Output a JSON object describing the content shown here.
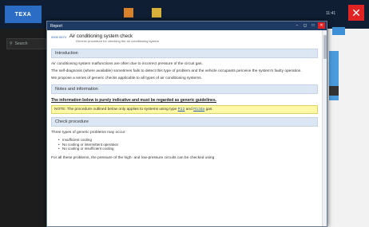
{
  "app": {
    "logo": "TEXA",
    "search_placeholder": "Search",
    "right_status": "11:41",
    "close_glyph": "✕"
  },
  "dialog": {
    "title": "Report",
    "controls": [
      "−",
      "◻",
      "□",
      "✕"
    ],
    "header": {
      "id": "0000 0673",
      "title": "Air conditioning system check",
      "subtitle": "Generic procedure for checking the air conditioning system"
    },
    "sections": {
      "introduction": "Introduction",
      "notes": "Notes and information",
      "check": "Check procedure"
    },
    "intro_paragraphs": [
      "Air conditioning system malfunctions are often due to incorrect pressure of the circuit gas.",
      "The self-diagnosis (where available) sometimes fails to detect this type of problem and the vehicle occupants perceive the system's faulty operation.",
      "We propose a series of generic checks applicable to all types of air conditioning systems."
    ],
    "warning": "The information below is purely indicative and must be regarded as generic guidelines.",
    "note": {
      "prefix": "NOTE: The procedure outlined below only applies to systems using type",
      "gas1": "R12",
      "mid": "and",
      "gas2": "R134a",
      "suffix": "gas."
    },
    "check_intro": "Three types of generic problems may occur:",
    "check_items": [
      "Insufficient cooling",
      "No cooling or intermittent operation",
      "No cooling or insufficient cooling"
    ],
    "closing": "For all these problems, the pressure of the high- and low-pressure circuits can be checked using"
  },
  "colors": {
    "titlebar": "#1f3a62",
    "section_bg": "#dde7f3",
    "note_bg": "#fff9a8",
    "close_red": "#e02424",
    "link_blue": "#2a5fb0"
  }
}
